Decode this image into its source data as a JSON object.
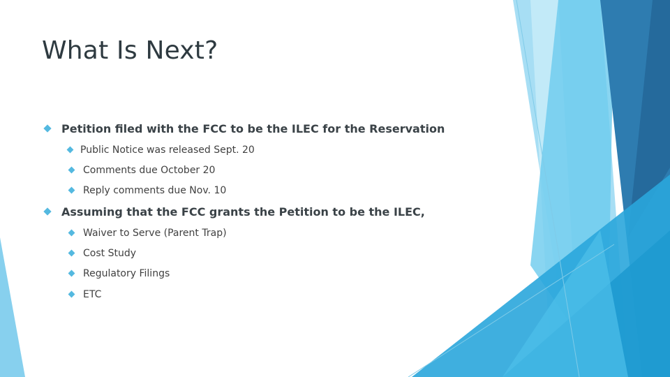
{
  "slide": {
    "title": "What Is Next?",
    "bullets": [
      {
        "text": "Petition filed with the FCC to be the ILEC for the Reservation",
        "sub": [
          "Public Notice was released Sept. 20",
          "Comments due October 20",
          "Reply comments due Nov. 10"
        ]
      },
      {
        "text": "Assuming that the FCC grants the Petition to be the ILEC,",
        "sub": [
          "Waiver to Serve (Parent Trap)",
          "Cost Study",
          "Regulatory Filings",
          "ETC"
        ]
      }
    ]
  },
  "theme": {
    "bullet_color": "#54b9e0",
    "title_color": "#2e3a40"
  }
}
